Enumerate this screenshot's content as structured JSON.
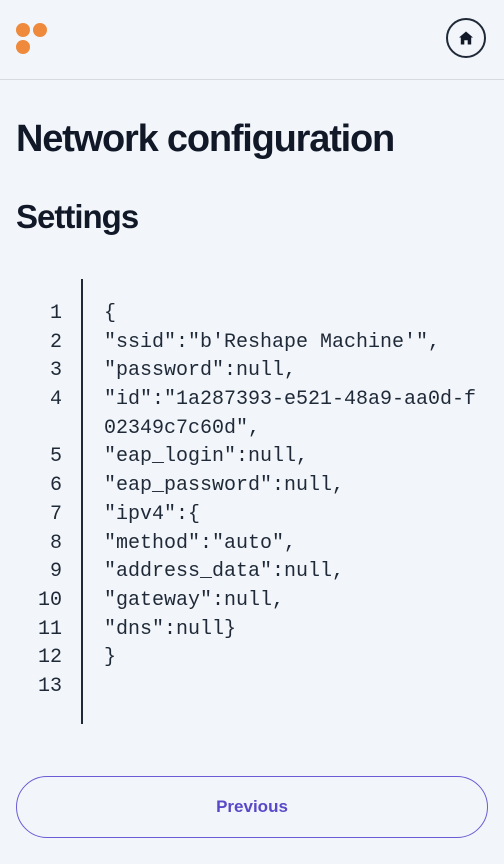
{
  "header": {
    "logo_icon": "brand-dots-logo",
    "brand_color": "#ef8a3c",
    "home_icon": "home-icon"
  },
  "page": {
    "title": "Network configuration",
    "section_title": "Settings"
  },
  "code": {
    "lines": [
      {
        "n": "1",
        "text": "{"
      },
      {
        "n": "2",
        "text": "\"ssid\":\"b'Reshape Machine'\","
      },
      {
        "n": "3",
        "text": "\"password\":null,"
      },
      {
        "n": "4",
        "text": "\"id\":\"1a287393-e521-48a9-aa0d-f02349c7c60d\","
      },
      {
        "n": "5",
        "text": "\"eap_login\":null,"
      },
      {
        "n": "6",
        "text": "\"eap_password\":null,"
      },
      {
        "n": "7",
        "text": "\"ipv4\":{"
      },
      {
        "n": "8",
        "text": "\"method\":\"auto\","
      },
      {
        "n": "9",
        "text": "\"address_data\":null,"
      },
      {
        "n": "10",
        "text": "\"gateway\":null,"
      },
      {
        "n": "11",
        "text": "\"dns\":null}"
      },
      {
        "n": "12",
        "text": "}"
      },
      {
        "n": "13",
        "text": ""
      }
    ]
  },
  "footer": {
    "previous_label": "Previous",
    "accent_color": "#6c5bd4"
  }
}
